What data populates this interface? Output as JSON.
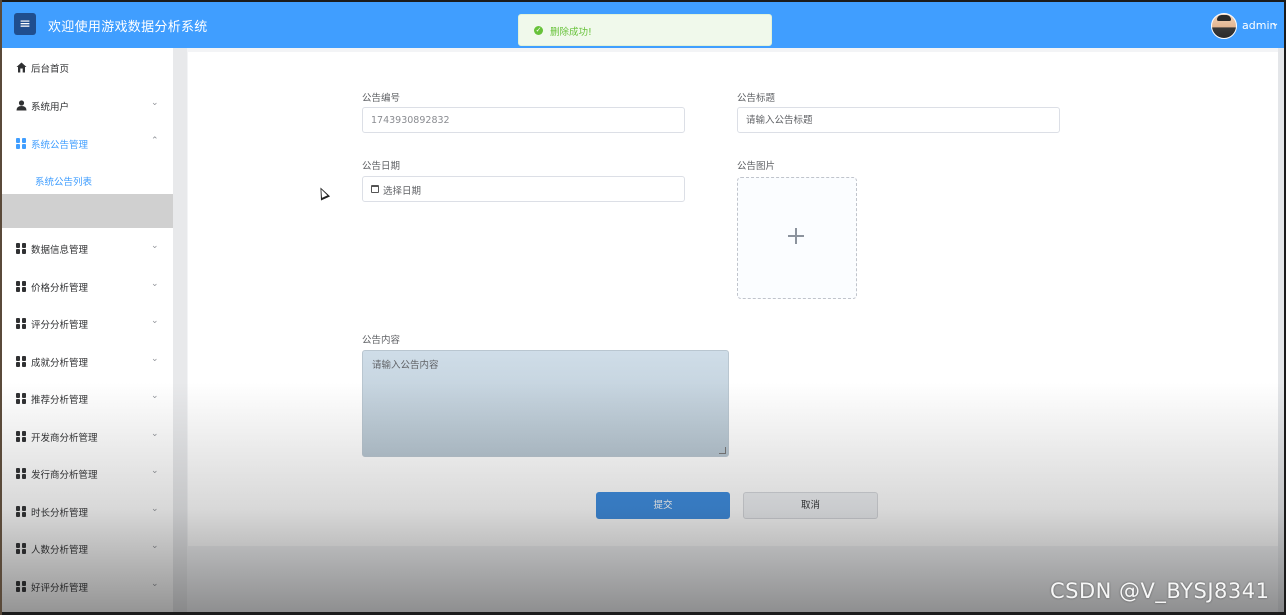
{
  "header": {
    "menu_icon": "hamburger-icon",
    "title": "欢迎使用游戏数据分析系统",
    "username": "admin",
    "caret": "⌄",
    "color": "#409eff"
  },
  "toast": {
    "icon": "check-circle-icon",
    "message": "删除成功!",
    "color": "#67c23a"
  },
  "sidebar": {
    "items": [
      {
        "label": "后台首页",
        "icon": "home-icon",
        "arrow": ""
      },
      {
        "label": "系统用户",
        "icon": "user-icon",
        "arrow": "⌄"
      },
      {
        "label": "系统公告管理",
        "icon": "grid-icon",
        "arrow": "⌃",
        "active": true
      },
      {
        "label": "数据信息管理",
        "icon": "grid-icon",
        "arrow": "⌄"
      },
      {
        "label": "价格分析管理",
        "icon": "grid-icon",
        "arrow": "⌄"
      },
      {
        "label": "评分分析管理",
        "icon": "grid-icon",
        "arrow": "⌄"
      },
      {
        "label": "成就分析管理",
        "icon": "grid-icon",
        "arrow": "⌄"
      },
      {
        "label": "推荐分析管理",
        "icon": "grid-icon",
        "arrow": "⌄"
      },
      {
        "label": "开发商分析管理",
        "icon": "grid-icon",
        "arrow": "⌄"
      },
      {
        "label": "发行商分析管理",
        "icon": "grid-icon",
        "arrow": "⌄"
      },
      {
        "label": "时长分析管理",
        "icon": "grid-icon",
        "arrow": "⌄"
      },
      {
        "label": "人数分析管理",
        "icon": "grid-icon",
        "arrow": "⌄"
      },
      {
        "label": "好评分析管理",
        "icon": "grid-icon",
        "arrow": "⌄"
      }
    ],
    "sub_item": {
      "label": "系统公告列表"
    }
  },
  "form": {
    "number_label": "公告编号",
    "number_value": "1743930892832",
    "title_label": "公告标题",
    "title_placeholder": "请输入公告标题",
    "date_label": "公告日期",
    "date_placeholder": "选择日期",
    "image_label": "公告图片",
    "content_label": "公告内容",
    "content_placeholder": "请输入公告内容",
    "submit_label": "提交",
    "cancel_label": "取消"
  },
  "watermark": "CSDN @V_BYSJ8341"
}
